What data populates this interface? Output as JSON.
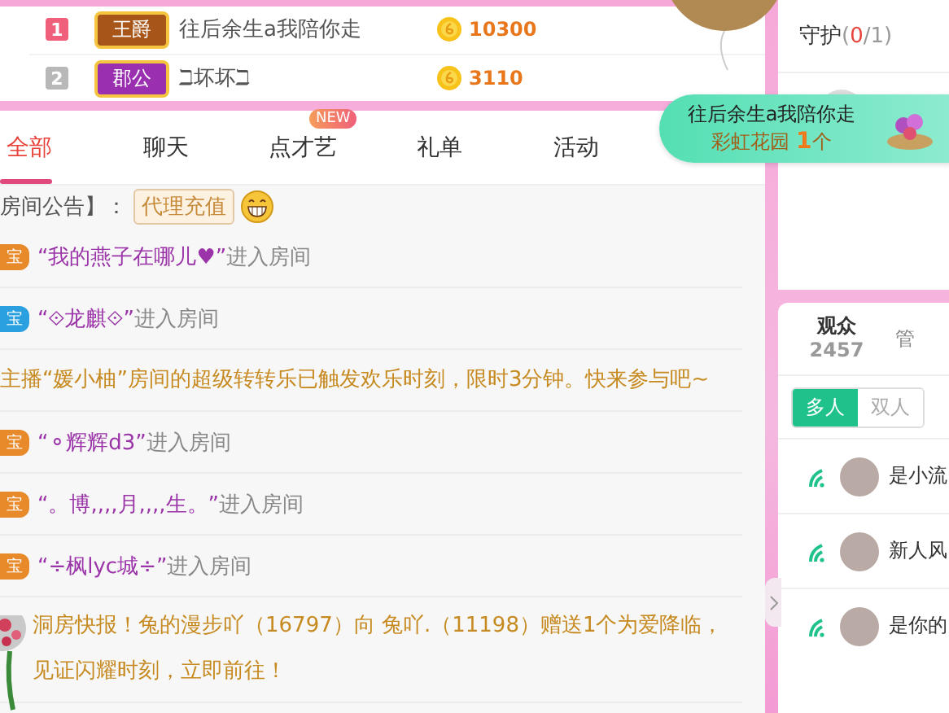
{
  "rank_board": {
    "rows": [
      {
        "rank": "1",
        "title": "王爵",
        "name": "往后余生a我陪你走",
        "amount": "10300"
      },
      {
        "rank": "2",
        "title": "郡公",
        "name": "ℶ坏坏ℶ",
        "amount": "3110"
      }
    ]
  },
  "tabs": [
    {
      "label": "全部",
      "selected": true
    },
    {
      "label": "聊天",
      "selected": false
    },
    {
      "label": "点才艺",
      "selected": false,
      "badge": "NEW"
    },
    {
      "label": "礼单",
      "selected": false
    },
    {
      "label": "活动",
      "selected": false
    }
  ],
  "messages": [
    {
      "kind": "notice",
      "prefix": "房间公告】：",
      "tag": "代理充值"
    },
    {
      "kind": "enter",
      "badge": "宝",
      "color": "#e8892a",
      "name": "“我的燕子在哪儿♥”",
      "action": "进入房间"
    },
    {
      "kind": "enter",
      "badge": "宝",
      "color": "#2aa0e0",
      "name": "“⟐龙麒⟐”",
      "action": "进入房间"
    },
    {
      "kind": "system",
      "text": "主播“媛小柚”房间的超级转转乐已触发欢乐时刻，限时3分钟。快来参与吧~"
    },
    {
      "kind": "enter",
      "badge": "宝",
      "color": "#e8892a",
      "name": "“⚬辉辉d3”",
      "action": "进入房间"
    },
    {
      "kind": "enter",
      "badge": "宝",
      "color": "#e8892a",
      "name": "“。博,,,,月,,,,生。”",
      "action": "进入房间"
    },
    {
      "kind": "enter",
      "badge": "宝",
      "color": "#e8892a",
      "name": "“÷枫lyc城÷”",
      "action": "进入房间"
    },
    {
      "kind": "system",
      "text": "洞房快报！兔的漫步吖（16797）向 兔吖.（11198）赠送1个为爱降临，见证闪耀时刻，立即前往！"
    }
  ],
  "guard": {
    "label": "守护",
    "count_before": "(",
    "count": "0",
    "count_after": "/1)"
  },
  "toast": {
    "name": "往后余生a我陪你走",
    "gift": "彩虹花园",
    "count": "1",
    "unit": "个"
  },
  "audience_tabs": [
    {
      "label": "观众",
      "count": "2457",
      "selected": true
    },
    {
      "label": "管",
      "selected": false
    }
  ],
  "mode_toggle": [
    {
      "label": "多人",
      "selected": true
    },
    {
      "label": "双人",
      "selected": false
    }
  ],
  "users": [
    {
      "name": "是小流"
    },
    {
      "name": "新人风"
    },
    {
      "name": "是你的"
    }
  ]
}
